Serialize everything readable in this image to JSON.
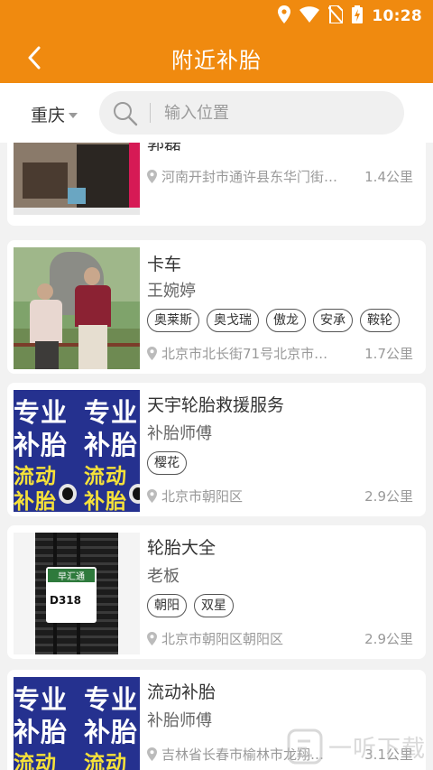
{
  "status_bar": {
    "time": "10:28"
  },
  "app_bar": {
    "title": "附近补胎"
  },
  "search": {
    "city": "重庆",
    "placeholder": "输入位置"
  },
  "shops": [
    {
      "name": "郭磊",
      "owner": "",
      "tags": [],
      "address": "河南开封市通许县东华门街…",
      "distance": "1.4公里"
    },
    {
      "name": "卡车",
      "owner": "王婉婷",
      "tags": [
        "奥莱斯",
        "奥戈瑞",
        "傲龙",
        "安承",
        "鞍轮"
      ],
      "address": "北京市北长街71号北京市…",
      "distance": "1.7公里"
    },
    {
      "name": "天宇轮胎救援服务",
      "owner": "补胎师傅",
      "tags": [
        "樱花"
      ],
      "address": "北京市朝阳区",
      "distance": "2.9公里",
      "poster_text": [
        "专业",
        "专业",
        "补胎",
        "补胎",
        "流动",
        "流动",
        "补胎",
        "补胎"
      ]
    },
    {
      "name": "轮胎大全",
      "owner": "老板",
      "tags": [
        "朝阳",
        "双星"
      ],
      "address": "北京市朝阳区朝阳区",
      "distance": "2.9公里",
      "tyre_brand": "早汇通",
      "tyre_code": "D318"
    },
    {
      "name": "流动补胎",
      "owner": "补胎师傅",
      "tags": [],
      "address": "吉林省长春市榆林市龙翔…",
      "distance": "3.1公里",
      "poster_text": [
        "专业",
        "专业",
        "补胎",
        "补胎",
        "流动",
        "流动"
      ]
    }
  ],
  "watermark": {
    "text": "一听下载"
  }
}
